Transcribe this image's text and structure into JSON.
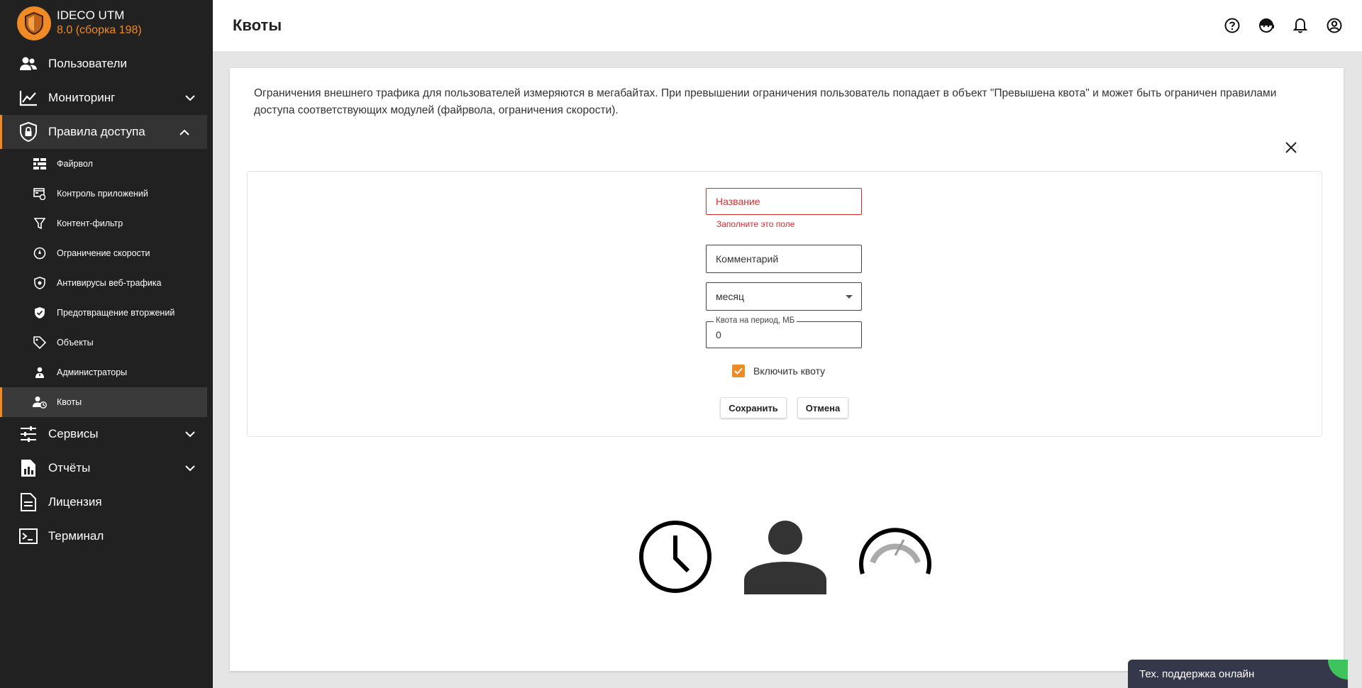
{
  "brand": {
    "title": "IDECO UTM",
    "version": "8.0 (сборка 198)"
  },
  "sidebar": {
    "items": [
      {
        "label": "Пользователи",
        "icon": "users-icon"
      },
      {
        "label": "Мониторинг",
        "icon": "chart-line-icon"
      },
      {
        "label": "Правила доступа",
        "icon": "shield-lock-icon"
      },
      {
        "label": "Сервисы",
        "icon": "sliders-icon"
      },
      {
        "label": "Отчёты",
        "icon": "report-icon"
      },
      {
        "label": "Лицензия",
        "icon": "document-icon"
      },
      {
        "label": "Терминал",
        "icon": "terminal-icon"
      }
    ],
    "subitems": [
      {
        "label": "Файрвол",
        "icon": "brick-wall-icon"
      },
      {
        "label": "Контроль приложений",
        "icon": "app-control-icon"
      },
      {
        "label": "Контент-фильтр",
        "icon": "filter-icon"
      },
      {
        "label": "Ограничение скорости",
        "icon": "speed-limit-icon"
      },
      {
        "label": "Антивирусы веб-трафика",
        "icon": "antivirus-shield-icon"
      },
      {
        "label": "Предотвращение вторжений",
        "icon": "shield-check-icon"
      },
      {
        "label": "Объекты",
        "icon": "tag-icon"
      },
      {
        "label": "Администраторы",
        "icon": "admin-icon"
      },
      {
        "label": "Квоты",
        "icon": "user-clock-icon"
      }
    ]
  },
  "header": {
    "title": "Квоты",
    "icons": [
      "help-icon",
      "support-face-icon",
      "bell-icon",
      "account-icon"
    ]
  },
  "main": {
    "description": "Ограничения внешнего трафика для пользователей измеряются в мегабайтах. При превышении ограничения пользователь попадает в объект \"Превышена квота\" и может быть ограничен правилами доступа соответствующих модулей (файрвола, ограничения скорости).",
    "form": {
      "name_placeholder": "Название",
      "name_error": "Заполните это поле",
      "comment_placeholder": "Комментарий",
      "period_value": "месяц",
      "quota_label": "Квота на период, МБ",
      "quota_value": "0",
      "enable_label": "Включить квоту",
      "enable_checked": true,
      "save_label": "Сохранить",
      "cancel_label": "Отмена"
    }
  },
  "support": {
    "label": "Тех. поддержка онлайн"
  },
  "colors": {
    "accent": "#f08a24",
    "sidebar_bg": "#212121",
    "error": "#d32f2f",
    "support_bg": "#34384a",
    "online": "#3ec45a"
  }
}
